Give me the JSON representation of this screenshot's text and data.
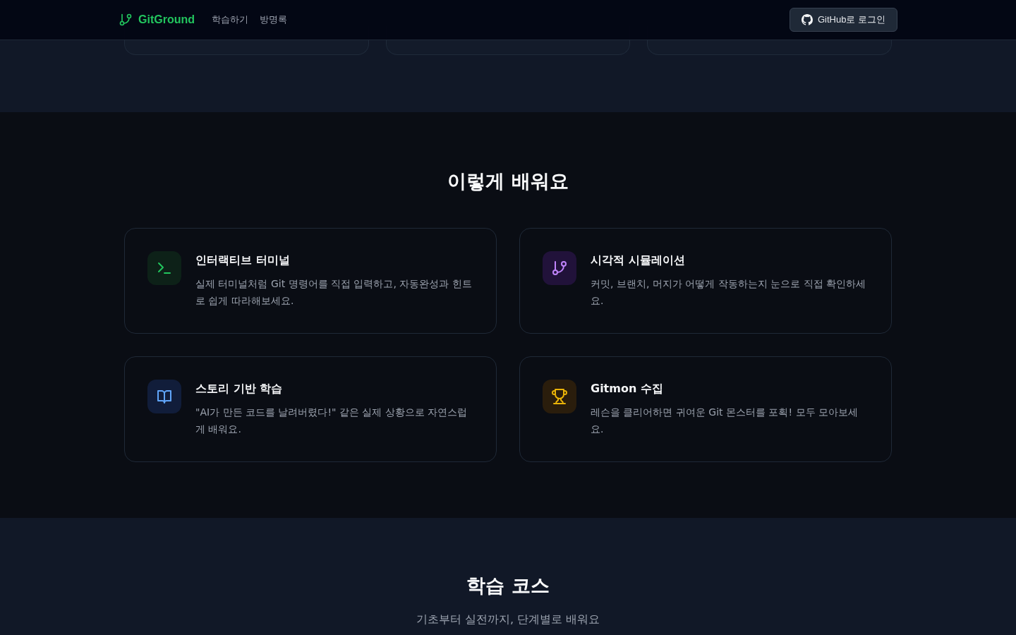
{
  "header": {
    "brand": "GitGround",
    "nav": [
      {
        "label": "학습하기"
      },
      {
        "label": "방명록"
      }
    ],
    "login_button": "GitHub로 로그인"
  },
  "features_section": {
    "title": "이렇게 배워요",
    "features": [
      {
        "kind": "terminal",
        "title": "인터랙티브 터미널",
        "description": "실제 터미널처럼 Git 명령어를 직접 입력하고, 자동완성과 힌트로 쉽게 따라해보세요."
      },
      {
        "kind": "branch",
        "title": "시각적 시뮬레이션",
        "description": "커밋, 브랜치, 머지가 어떻게 작동하는지 눈으로 직접 확인하세요."
      },
      {
        "kind": "book",
        "title": "스토리 기반 학습",
        "description": "\"AI가 만든 코드를 날려버렸다!\" 같은 실제 상황으로 자연스럽게 배워요."
      },
      {
        "kind": "trophy",
        "title": "Gitmon 수집",
        "description": "레슨을 클리어하면 귀여운 Git 몬스터를 포획! 모두 모아보세요."
      }
    ]
  },
  "courses_section": {
    "title": "학습 코스",
    "subtitle": "기초부터 실전까지, 단계별로 배워요"
  }
}
